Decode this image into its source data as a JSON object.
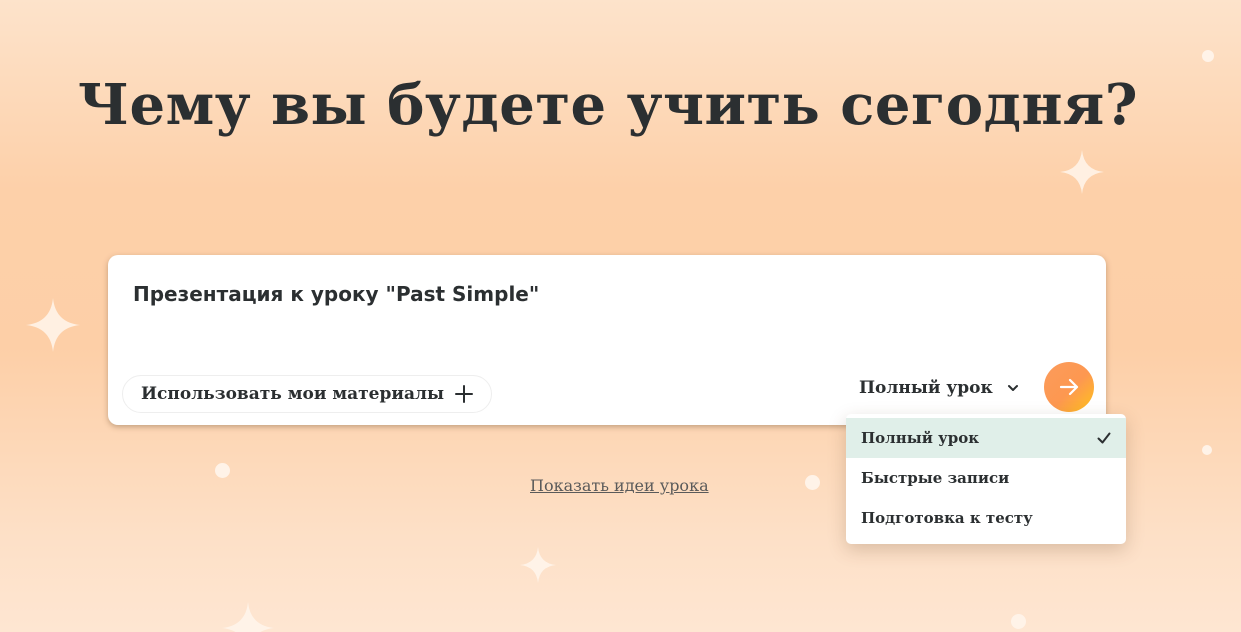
{
  "heading": "Чему вы будете учить сегодня?",
  "prompt": {
    "text": "Презентация к уроку \"Past Simple\""
  },
  "materials_button": {
    "label": "Использовать мои материалы",
    "icon": "plus-icon"
  },
  "mode_select": {
    "selected": "Полный урок",
    "icon": "chevron-down-icon"
  },
  "submit_button": {
    "icon": "arrow-right-icon"
  },
  "dropdown": {
    "options": [
      {
        "label": "Полный урок",
        "selected": true
      },
      {
        "label": "Быстрые записи",
        "selected": false
      },
      {
        "label": "Подготовка к тесту",
        "selected": false
      }
    ],
    "check_icon": "checkmark-icon"
  },
  "ideas_link": "Показать идеи урока",
  "colors": {
    "background": "#fdcfa7",
    "text": "#2b2f31",
    "accent_orange": "#fd9850",
    "accent_yellow": "#ffc21b",
    "selected_option_bg": "#e0efe9"
  }
}
